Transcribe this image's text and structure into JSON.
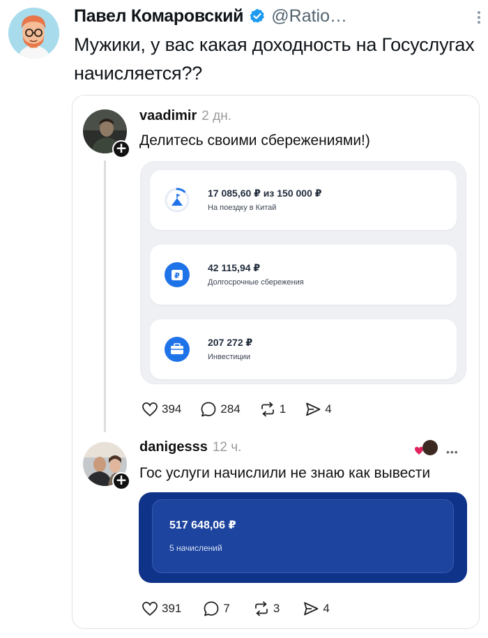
{
  "tweet": {
    "author_name": "Павел Комаровский",
    "handle": "@Ratio…",
    "text": "Мужики, у вас какая доходность на Госуслугах начисляется??",
    "avatar_icon": "cartoon-person-avatar",
    "verified_icon": "verified-badge-icon"
  },
  "thread": {
    "post": {
      "username": "vaadimir",
      "time": "2 дн.",
      "text": "Делитесь своими сбережениями!)",
      "savings": [
        {
          "amount": "17 085,60 ₽ из 150 000 ₽",
          "label": "На поездку в Китай",
          "icon": "travel-goal-icon",
          "progress": 0.11
        },
        {
          "amount": "42 115,94 ₽",
          "label": "Долгосрочные сбережения",
          "icon": "ruble-wallet-icon"
        },
        {
          "amount": "207 272 ₽",
          "label": "Инвестиции",
          "icon": "briefcase-icon"
        }
      ],
      "stats": {
        "likes": "394",
        "comments": "284",
        "reposts": "1",
        "shares": "4"
      }
    },
    "reply": {
      "username": "danigesss",
      "time": "12 ч.",
      "text": "Гос услуги начислили не знаю как вывести",
      "balance_amount": "517 648,06 ₽",
      "balance_label": "5 начислений",
      "stats": {
        "likes": "391",
        "comments": "7",
        "reposts": "3",
        "shares": "4"
      }
    }
  },
  "colors": {
    "accent_blue": "#1d9bf0",
    "gosuslugi_blue": "#1f73e8",
    "balance_card": "#0f3389",
    "muted_text": "#536471"
  }
}
